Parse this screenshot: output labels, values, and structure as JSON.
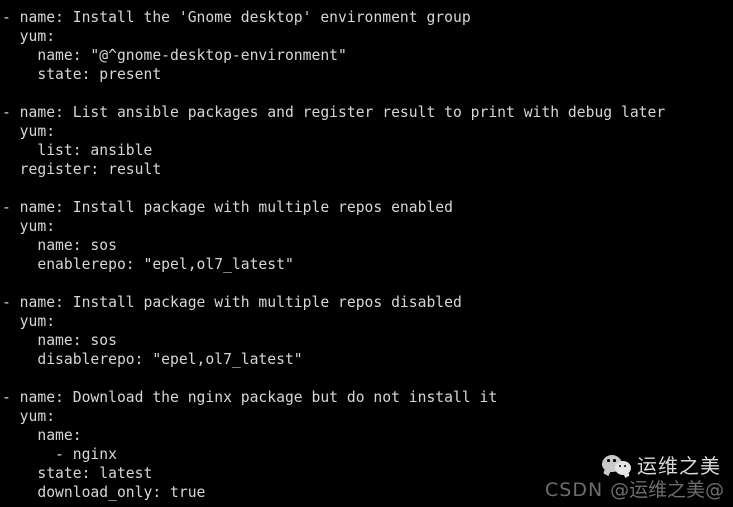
{
  "terminal": {
    "background_color": "#000000",
    "text_color": "#d6d6d6",
    "lines": [
      "- name: Install the 'Gnome desktop' environment group",
      "  yum:",
      "    name: \"@^gnome-desktop-environment\"",
      "    state: present",
      "",
      "- name: List ansible packages and register result to print with debug later",
      "  yum:",
      "    list: ansible",
      "  register: result",
      "",
      "- name: Install package with multiple repos enabled",
      "  yum:",
      "    name: sos",
      "    enablerepo: \"epel,ol7_latest\"",
      "",
      "- name: Install package with multiple repos disabled",
      "  yum:",
      "    name: sos",
      "    disablerepo: \"epel,ol7_latest\"",
      "",
      "- name: Download the nginx package but do not install it",
      "  yum:",
      "    name:",
      "      - nginx",
      "    state: latest",
      "    download_only: true"
    ]
  },
  "watermark": {
    "csdn_label": "CSDN",
    "handle": "@运维之美@",
    "brand_cn": "运维之美",
    "logo_icon": "wechat-icon",
    "csdn_color": "#6d6d6d",
    "brand_color": "#d8d8d8"
  }
}
